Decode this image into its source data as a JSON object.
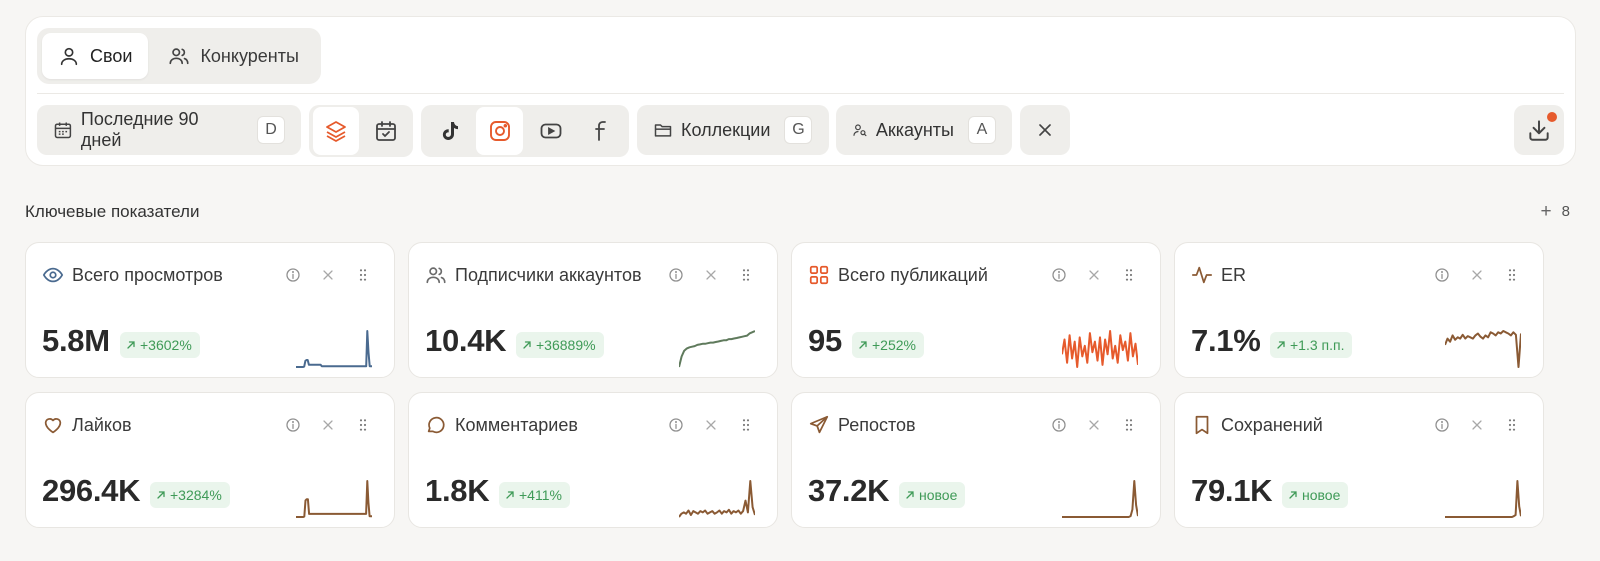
{
  "tabs": [
    {
      "label": "Свои",
      "icon": "user-icon",
      "active": true
    },
    {
      "label": "Конкуренты",
      "icon": "users-icon",
      "active": false
    }
  ],
  "filters": {
    "period": {
      "label": "Последние 90 дней",
      "key": "D"
    },
    "collections": {
      "label": "Коллекции",
      "key": "G"
    },
    "accounts": {
      "label": "Аккаунты",
      "key": "A"
    }
  },
  "accent_color": "#e65a2c",
  "section": {
    "title": "Ключевые показатели",
    "add_count": "8"
  },
  "metrics": [
    {
      "title": "Всего просмотров",
      "value": "5.8M",
      "delta": "+3602%",
      "icon": "eye-icon",
      "color": "#4a6a8f",
      "spark": [
        2,
        2,
        2,
        2,
        2,
        2,
        2,
        3,
        18,
        20,
        20,
        8,
        8,
        8,
        8,
        8,
        8,
        8,
        8,
        8,
        8,
        8,
        4,
        4,
        4,
        4,
        4,
        4,
        4,
        4,
        4,
        4,
        4,
        4,
        4,
        4,
        4,
        4,
        4,
        4,
        4,
        4,
        4,
        4,
        4,
        4,
        4,
        4,
        4,
        4,
        4,
        4,
        4,
        4,
        4,
        4,
        4,
        4,
        4,
        4,
        4,
        95,
        40,
        4,
        4,
        4
      ]
    },
    {
      "title": "Подписчики аккаунтов",
      "value": "10.4K",
      "delta": "+36889%",
      "icon": "users-icon",
      "color": "#5f7a5c",
      "spark": [
        2,
        20,
        30,
        34,
        36,
        37,
        38,
        40,
        41,
        42,
        42,
        43,
        44,
        44,
        45,
        46,
        47,
        48,
        48,
        50,
        50,
        51,
        52,
        53,
        54,
        55,
        56,
        60,
        62,
        64
      ]
    },
    {
      "title": "Всего публикаций",
      "value": "95",
      "delta": "+252%",
      "icon": "grid-icon",
      "color": "#e65a2c",
      "spark": [
        40,
        75,
        20,
        85,
        30,
        70,
        10,
        80,
        35,
        60,
        20,
        90,
        45,
        70,
        25,
        80,
        15,
        75,
        40,
        95,
        30,
        60,
        20,
        85,
        50,
        70,
        25,
        90,
        35,
        65,
        15
      ]
    },
    {
      "title": "ER",
      "value": "7.1%",
      "delta": "+1.3 п.п.",
      "icon": "activity-icon",
      "color": "#8a5a34",
      "spark": [
        40,
        50,
        45,
        55,
        48,
        52,
        50,
        56,
        50,
        54,
        52,
        50,
        55,
        58,
        53,
        50,
        55,
        52,
        60,
        58,
        55,
        60,
        58,
        62,
        60,
        58,
        55,
        60,
        56,
        5,
        58
      ]
    },
    {
      "title": "Лайков",
      "value": "296.4K",
      "delta": "+3284%",
      "icon": "heart-icon",
      "color": "#8a5a34",
      "spark": [
        2,
        2,
        2,
        2,
        2,
        2,
        2,
        3,
        45,
        48,
        48,
        10,
        10,
        10,
        10,
        10,
        10,
        10,
        10,
        10,
        10,
        10,
        10,
        10,
        10,
        10,
        10,
        10,
        10,
        10,
        10,
        10,
        10,
        10,
        10,
        10,
        10,
        10,
        10,
        10,
        10,
        10,
        10,
        10,
        10,
        10,
        10,
        10,
        10,
        10,
        10,
        10,
        10,
        10,
        10,
        10,
        10,
        10,
        10,
        10,
        95,
        40,
        4,
        4,
        4
      ]
    },
    {
      "title": "Комментариев",
      "value": "1.8K",
      "delta": "+411%",
      "icon": "message-icon",
      "color": "#8a5a34",
      "spark": [
        5,
        10,
        12,
        10,
        15,
        8,
        14,
        12,
        10,
        14,
        12,
        15,
        10,
        12,
        14,
        10,
        12,
        15,
        10,
        14,
        12,
        16,
        10,
        14,
        12,
        15,
        10,
        14,
        30,
        12,
        60,
        20,
        8
      ]
    },
    {
      "title": "Репостов",
      "value": "37.2K",
      "delta": "новое",
      "icon": "send-icon",
      "color": "#8a5a34",
      "spark": [
        3,
        3,
        3,
        3,
        3,
        3,
        3,
        3,
        3,
        3,
        3,
        3,
        3,
        3,
        3,
        3,
        3,
        3,
        3,
        3,
        3,
        3,
        3,
        3,
        3,
        3,
        3,
        3,
        3,
        3,
        3,
        3,
        3,
        3,
        3,
        3,
        3,
        5,
        20,
        85,
        30,
        5
      ]
    },
    {
      "title": "Сохранений",
      "value": "79.1K",
      "delta": "новое",
      "icon": "bookmark-icon",
      "color": "#8a5a34",
      "spark": [
        3,
        3,
        3,
        3,
        3,
        3,
        3,
        3,
        3,
        3,
        3,
        3,
        3,
        3,
        3,
        3,
        3,
        3,
        3,
        3,
        3,
        3,
        3,
        3,
        3,
        3,
        3,
        3,
        3,
        3,
        3,
        3,
        3,
        3,
        3,
        3,
        3,
        3,
        5,
        8,
        95,
        30,
        5
      ]
    }
  ]
}
